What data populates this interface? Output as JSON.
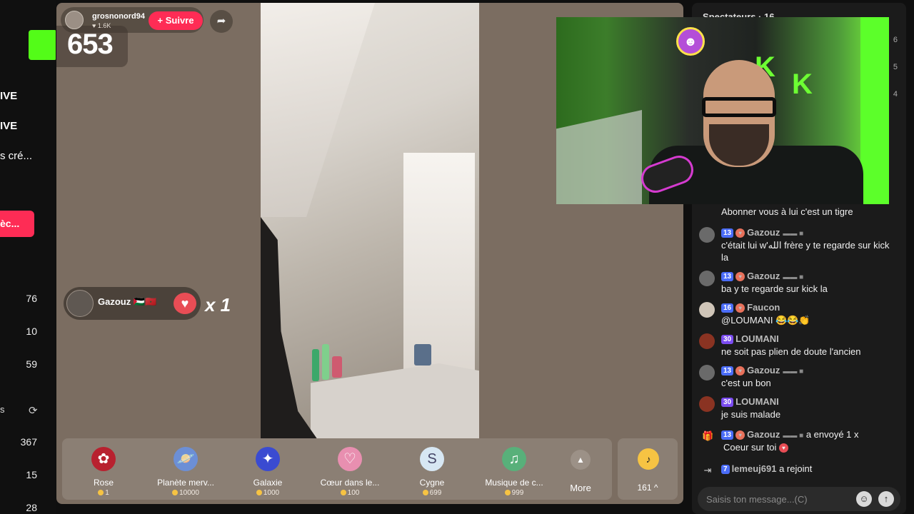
{
  "sidebar": {
    "nav": [
      "IVE",
      "IVE",
      "s cré..."
    ],
    "button_label": "èc...",
    "counts_top": [
      "76",
      "10",
      "59"
    ],
    "section_label": "s",
    "counts_bottom": [
      "367",
      "15",
      "28"
    ]
  },
  "host": {
    "name": "grosnonord94",
    "likes": "♥ 1.6K",
    "follow_label": "+ Suivre",
    "score": "653"
  },
  "gift_toast": {
    "user": "Gazouz 🇵🇸🇲🇦",
    "multiplier": "x 1"
  },
  "gift_bar": {
    "items": [
      {
        "name": "Rose",
        "price": "1",
        "icon": "rose-icon"
      },
      {
        "name": "Planète merv...",
        "price": "10000",
        "icon": "planet-icon"
      },
      {
        "name": "Galaxie",
        "price": "1000",
        "icon": "galaxy-icon"
      },
      {
        "name": "Cœur dans le...",
        "price": "100",
        "icon": "heart-hands-icon"
      },
      {
        "name": "Cygne",
        "price": "699",
        "icon": "swan-icon"
      },
      {
        "name": "Musique de c...",
        "price": "999",
        "icon": "music-icon"
      }
    ],
    "more_label": "More",
    "coin_balance": "161 ^"
  },
  "chat": {
    "spectators_label": "Spectateurs · 16",
    "rank_numbers": [
      "6",
      "5",
      "4"
    ],
    "messages": [
      {
        "body": "Abonner vous à lui c'est un tigre"
      },
      {
        "level": "13",
        "user": "Gazouz",
        "body": "c'était lui w'الله frère y te regarde sur kick la"
      },
      {
        "level": "13",
        "user": "Gazouz",
        "body": "ba y te regarde sur kick la"
      },
      {
        "level": "16",
        "user": "Faucon",
        "body": "@LOUMANI 😂😂👏"
      },
      {
        "level": "30",
        "user": "LOUMANI",
        "body": "ne soit pas plien de doute l'ancien"
      },
      {
        "level": "13",
        "user": "Gazouz",
        "body": "c'est un bon"
      },
      {
        "level": "30",
        "user": "LOUMANI",
        "body": "je suis malade"
      }
    ],
    "gift_event": {
      "level": "13",
      "user": "Gazouz",
      "action": "a envoyé 1 x",
      "gift": "Coeur sur toi"
    },
    "join_event": {
      "level": "7",
      "user": "lemeuj691",
      "action": "a rejoint"
    },
    "input_placeholder": "Saisis ton message...(C)"
  },
  "colors": {
    "follow": "#fe2c55",
    "kick_green": "#53fc18",
    "level_blue": "#4a6cf7",
    "level_purple": "#7b4cf0"
  }
}
